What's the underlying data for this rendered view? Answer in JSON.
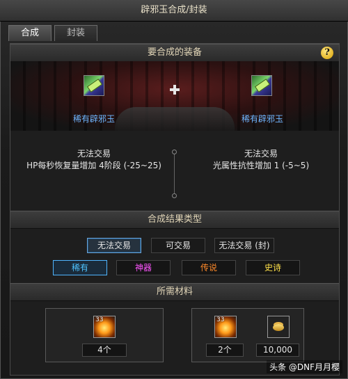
{
  "window": {
    "title": "辟邪玉合成/封装"
  },
  "tabs": [
    {
      "label": "合成",
      "active": true
    },
    {
      "label": "封装",
      "active": false
    }
  ],
  "sections": {
    "equipment": "要合成的装备",
    "result_type": "合成结果类型",
    "materials": "所需材料"
  },
  "help": {
    "glyph": "?"
  },
  "slots": [
    {
      "name": "稀有辟邪玉",
      "trade": "无法交易",
      "stat": "HP每秒恢复量增加 4阶段 (-25~25)"
    },
    {
      "name": "稀有辟邪玉",
      "trade": "无法交易",
      "stat": "光属性抗性增加 1 (-5~5)"
    }
  ],
  "trade_options": [
    {
      "label": "无法交易",
      "selected": true
    },
    {
      "label": "可交易",
      "selected": false
    },
    {
      "label": "无法交易 (封)",
      "selected": false
    }
  ],
  "rarity_options": [
    {
      "label": "稀有",
      "color": "#4fc3ff",
      "selected": true
    },
    {
      "label": "神器",
      "color": "#ff55ff",
      "selected": false
    },
    {
      "label": "传说",
      "color": "#ff8a2a",
      "selected": false
    },
    {
      "label": "史诗",
      "color": "#ffe14a",
      "selected": false
    }
  ],
  "materials": {
    "left": {
      "stack": "33",
      "qty": "4个"
    },
    "right": {
      "stack": "33",
      "qty": "2个",
      "gold": "10,000"
    }
  },
  "watermark": "头条 @DNF月月樱"
}
